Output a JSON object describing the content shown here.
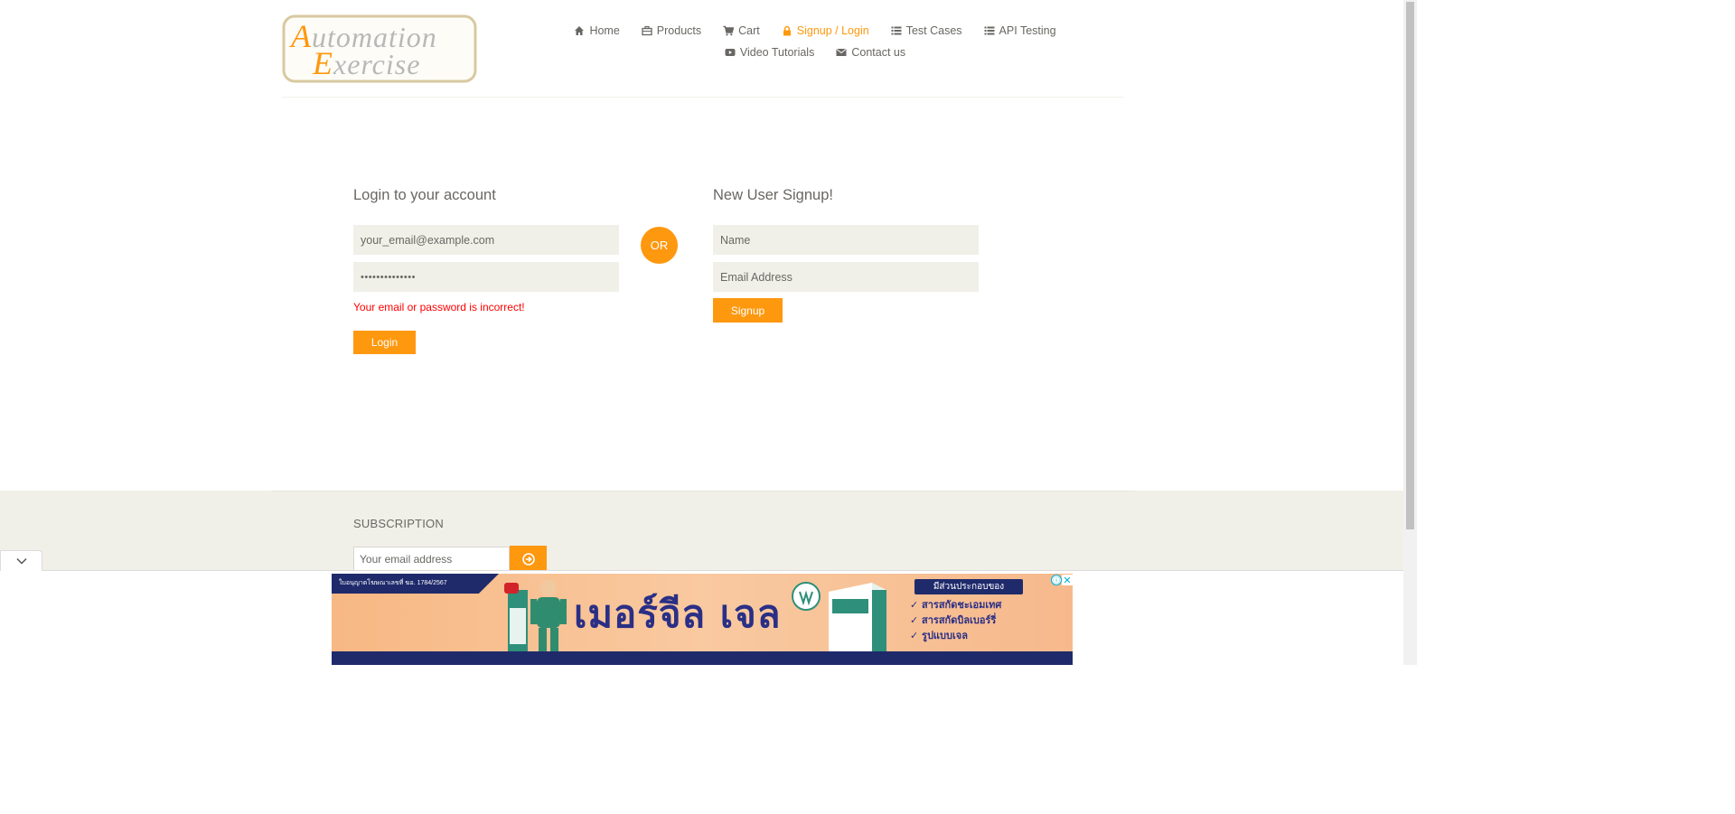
{
  "brand": {
    "line1": "Automation",
    "line2": "Exercise"
  },
  "nav": [
    {
      "label": "Home",
      "icon": "home-icon"
    },
    {
      "label": "Products",
      "icon": "briefcase-icon"
    },
    {
      "label": "Cart",
      "icon": "cart-icon"
    },
    {
      "label": "Signup / Login",
      "icon": "lock-icon",
      "active": true
    },
    {
      "label": "Test Cases",
      "icon": "list-icon"
    },
    {
      "label": "API Testing",
      "icon": "list-icon"
    },
    {
      "label": "Video Tutorials",
      "icon": "youtube-play-icon"
    },
    {
      "label": "Contact us",
      "icon": "envelope-icon"
    }
  ],
  "login": {
    "title": "Login to your account",
    "email_value": "your_email@example.com",
    "password_value": "••••••••••••••",
    "error": "Your email or password is incorrect!",
    "button": "Login"
  },
  "or_label": "OR",
  "signup": {
    "title": "New User Signup!",
    "name_placeholder": "Name",
    "email_placeholder": "Email Address",
    "button": "Signup"
  },
  "footer": {
    "subscription_title": "SUBSCRIPTION",
    "subscription_placeholder": "Your email address"
  },
  "ad": {
    "top_left_text": "ใบอนุญาตโฆษณาเลขที่ ฆอ. 1784/2567",
    "headline": "เมอร์จีล เจล",
    "right_title": "มีส่วนประกอบของ",
    "bullets": [
      "✓ สารสกัดชะเอมเทศ",
      "✓ สารสกัดบิลเบอร์รี่",
      "✓ รูปแบบเจล"
    ],
    "info_symbol": "ⓘ",
    "close_symbol": "✕"
  },
  "colors": {
    "accent": "#FE980F",
    "text": "#696763",
    "field_bg": "#F0F0E9",
    "error": "#FF0000"
  }
}
